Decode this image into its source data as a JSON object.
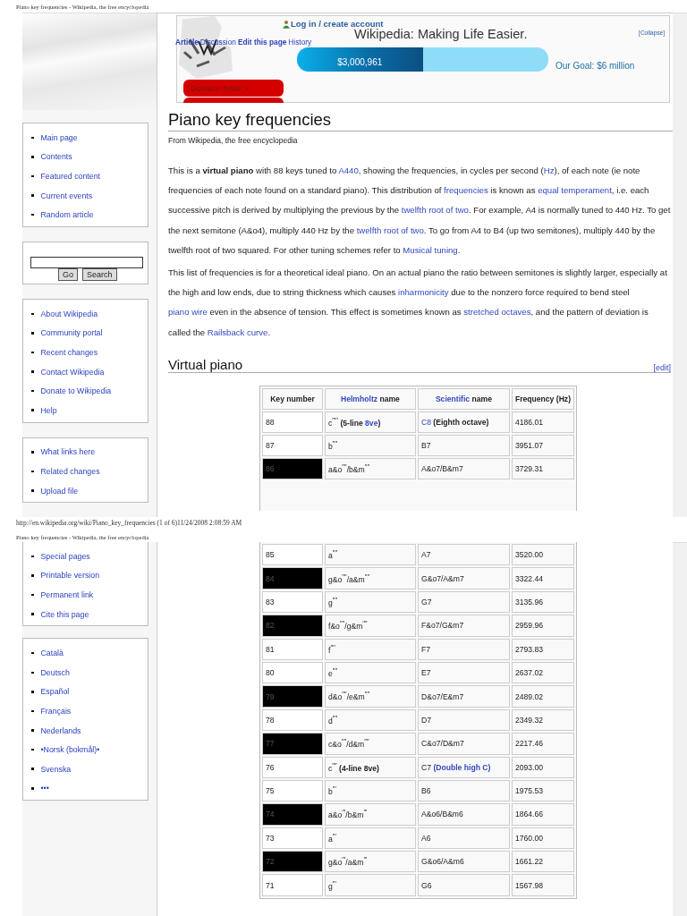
{
  "sheets": [
    {
      "running_head": "Piano key frequencies - Wikipedia, the free encyclopedia",
      "running_foot": "http://en.wikipedia.org/wiki/Piano_key_frequencies (1 of 6)11/24/2008 2:08:59 AM",
      "sidebar": [
        {
          "kind": "links",
          "items": [
            "Main page",
            "Contents",
            "Featured content",
            "Current events",
            "Random article"
          ]
        },
        {
          "kind": "search",
          "buttons": [
            "Go",
            "Search"
          ]
        },
        {
          "kind": "links",
          "items": [
            "About Wikipedia",
            "Community portal",
            "Recent changes",
            "Contact Wikipedia",
            "Donate to Wikipedia",
            "Help"
          ]
        },
        {
          "kind": "links",
          "items": [
            "What links here",
            "Related changes",
            "Upload file"
          ]
        }
      ]
    },
    {
      "running_head": "Piano key frequencies - Wikipedia, the free encyclopedia",
      "sidebar": [
        {
          "kind": "links",
          "items": [
            "Special pages",
            "Printable version",
            "Permanent link",
            "Cite this page"
          ]
        },
        {
          "kind": "links",
          "items": [
            "Català",
            "Deutsch",
            "Español",
            "Français",
            "Nederlands",
            "•Norsk (bokmål)•",
            "Svenska",
            "•••"
          ]
        }
      ]
    }
  ],
  "banner": {
    "login": "Log in / create account",
    "tabs": [
      {
        "label": "Article",
        "bold": true
      },
      {
        "label": "Discussion",
        "bold": false
      },
      {
        "label": "Edit this page",
        "bold": true
      },
      {
        "label": "History",
        "bold": false
      }
    ],
    "slogan": "Wikipedia: Making Life Easier.",
    "collapse": "[Collapse]",
    "progress": {
      "level": 0.5,
      "reading": "$3,000,961"
    },
    "goal": "Our Goal: $6 million",
    "donate": "Donate Now »"
  },
  "article": {
    "title": "Piano key frequencies",
    "subtitle": "From Wikipedia, the free encyclopedia",
    "paragraphs": [
      [
        {
          "kind": "text",
          "t": "This is a "
        },
        {
          "kind": "bold",
          "t": "virtual piano"
        },
        {
          "kind": "text",
          "t": " with 88 keys tuned to "
        },
        {
          "kind": "link",
          "t": "A440"
        },
        {
          "kind": "text",
          "t": ", showing the frequencies, in cycles per second ("
        },
        {
          "kind": "link",
          "t": "Hz"
        },
        {
          "kind": "text",
          "t": "), of each note (ie note frequencies of each note found on a standard piano). This distribution of "
        },
        {
          "kind": "link",
          "t": "frequencies"
        },
        {
          "kind": "text",
          "t": " is known as "
        },
        {
          "kind": "link",
          "t": "equal temperament"
        },
        {
          "kind": "text",
          "t": ", i.e. each successive pitch is derived by multiplying the previous by the "
        },
        {
          "kind": "link",
          "t": "twelfth root of two"
        },
        {
          "kind": "text",
          "t": ". For example, A4 is normally tuned to 440 Hz. To get the next semitone (A&o4), multiply 440 Hz by the "
        },
        {
          "kind": "link",
          "t": "twelfth root of two"
        },
        {
          "kind": "text",
          "t": ". To go from A4 to B4 (up two semitones), multiply 440 by the twelfth root of two squared. For other tuning schemes refer to "
        },
        {
          "kind": "link",
          "t": "Musical tuning"
        },
        {
          "kind": "text",
          "t": "."
        }
      ],
      [
        {
          "kind": "text",
          "t": "This list of frequencies is for a theoretical ideal piano. On an actual piano the ratio between semitones is slightly larger, especially at the high and low ends, due to string thickness which causes "
        },
        {
          "kind": "link",
          "t": "inharmonicity"
        },
        {
          "kind": "text",
          "t": " due to the nonzero force required to bend steel "
        },
        {
          "kind": "link",
          "t": "piano wire"
        },
        {
          "kind": "text",
          "t": " even in the absence of tension. This effect is sometimes known as "
        },
        {
          "kind": "link",
          "t": "stretched octaves"
        },
        {
          "kind": "text",
          "t": ", and the pattern of deviation is called the "
        },
        {
          "kind": "link",
          "t": "Railsback curve"
        },
        {
          "kind": "text",
          "t": "."
        }
      ]
    ],
    "section": {
      "heading": "Virtual piano",
      "edit": "[edit]"
    },
    "table": {
      "columns": [
        [
          {
            "kind": "bold",
            "t": "Key number"
          }
        ],
        [
          {
            "kind": "link",
            "t": "Helmholtz"
          },
          {
            "kind": "bold",
            "t": " name"
          }
        ],
        [
          {
            "kind": "link",
            "t": "Scientific"
          },
          {
            "kind": "bold",
            "t": " name"
          }
        ],
        [
          {
            "kind": "bold",
            "t": "Frequency (Hz)"
          }
        ]
      ],
      "sheet_1_rows": [
        {
          "key": "88",
          "black": false,
          "helmholtz": [
            {
              "kind": "text",
              "t": "c$^{′′′′′}$ "
            },
            {
              "kind": "bold",
              "t": "(5-line "
            },
            {
              "kind": "link",
              "t": "8ve"
            },
            {
              "kind": "bold",
              "t": ")"
            }
          ],
          "scientific": [
            {
              "kind": "link",
              "t": "C8"
            },
            {
              "kind": "bold",
              "t": " (Eighth octave)"
            }
          ],
          "frequency": "4186.01"
        },
        {
          "key": "87",
          "black": false,
          "helmholtz": [
            {
              "kind": "text",
              "t": "b$^{′′′′}$"
            }
          ],
          "scientific": [
            {
              "kind": "text",
              "t": "B7"
            }
          ],
          "frequency": "3951.07"
        },
        {
          "key": "86",
          "black": true,
          "helmholtz": [
            {
              "kind": "text",
              "t": "a&o$^{′′′′}$/b&m$^{′′′′}$"
            }
          ],
          "scientific": [
            {
              "kind": "text",
              "t": "A&o7/B&m7"
            }
          ],
          "frequency": "3729.31"
        }
      ],
      "sheet_2_rows": [
        {
          "key": "85",
          "black": false,
          "helmholtz": [
            {
              "kind": "text",
              "t": "a$^{′′′′}$"
            }
          ],
          "scientific": [
            {
              "kind": "text",
              "t": "A7"
            }
          ],
          "frequency": "3520.00"
        },
        {
          "key": "84",
          "black": true,
          "helmholtz": [
            {
              "kind": "text",
              "t": "g&o$^{′′′′}$/a&m$^{′′′′}$"
            }
          ],
          "scientific": [
            {
              "kind": "text",
              "t": "G&o7/A&m7"
            }
          ],
          "frequency": "3322.44"
        },
        {
          "key": "83",
          "black": false,
          "helmholtz": [
            {
              "kind": "text",
              "t": "g$^{′′′′}$"
            }
          ],
          "scientific": [
            {
              "kind": "text",
              "t": "G7"
            }
          ],
          "frequency": "3135.96"
        },
        {
          "key": "82",
          "black": true,
          "helmholtz": [
            {
              "kind": "text",
              "t": "f&o$^{′′′′}$/g&m$^{′′′′}$"
            }
          ],
          "scientific": [
            {
              "kind": "text",
              "t": "F&o7/G&m7"
            }
          ],
          "frequency": "2959.96"
        },
        {
          "key": "81",
          "black": false,
          "helmholtz": [
            {
              "kind": "text",
              "t": "f$^{′′′′}$"
            }
          ],
          "scientific": [
            {
              "kind": "text",
              "t": "F7"
            }
          ],
          "frequency": "2793.83"
        },
        {
          "key": "80",
          "black": false,
          "helmholtz": [
            {
              "kind": "text",
              "t": "e$^{′′′′}$"
            }
          ],
          "scientific": [
            {
              "kind": "text",
              "t": "E7"
            }
          ],
          "frequency": "2637.02"
        },
        {
          "key": "79",
          "black": true,
          "helmholtz": [
            {
              "kind": "text",
              "t": "d&o$^{′′′′}$/e&m$^{′′′′}$"
            }
          ],
          "scientific": [
            {
              "kind": "text",
              "t": "D&o7/E&m7"
            }
          ],
          "frequency": "2489.02"
        },
        {
          "key": "78",
          "black": false,
          "helmholtz": [
            {
              "kind": "text",
              "t": "d$^{′′′′}$"
            }
          ],
          "scientific": [
            {
              "kind": "text",
              "t": "D7"
            }
          ],
          "frequency": "2349.32"
        },
        {
          "key": "77",
          "black": true,
          "helmholtz": [
            {
              "kind": "text",
              "t": "c&o$^{′′′′}$/d&m$^{′′′′}$"
            }
          ],
          "scientific": [
            {
              "kind": "text",
              "t": "C&o7/D&m7"
            }
          ],
          "frequency": "2217.46"
        },
        {
          "key": "76",
          "black": false,
          "helmholtz": [
            {
              "kind": "text",
              "t": "c$^{′′′′}$ "
            },
            {
              "kind": "bold",
              "t": "(4-line 8ve)"
            }
          ],
          "scientific": [
            {
              "kind": "text",
              "t": "C7 "
            },
            {
              "kind": "link",
              "t": "(Double high C)"
            }
          ],
          "frequency": "2093.00"
        },
        {
          "key": "75",
          "black": false,
          "helmholtz": [
            {
              "kind": "text",
              "t": "b$^{′′′}$"
            }
          ],
          "scientific": [
            {
              "kind": "text",
              "t": "B6"
            }
          ],
          "frequency": "1975.53"
        },
        {
          "key": "74",
          "black": true,
          "helmholtz": [
            {
              "kind": "text",
              "t": "a&o$^{′′′}$/b&m$^{′′′}$"
            }
          ],
          "scientific": [
            {
              "kind": "text",
              "t": "A&o6/B&m6"
            }
          ],
          "frequency": "1864.66"
        },
        {
          "key": "73",
          "black": false,
          "helmholtz": [
            {
              "kind": "text",
              "t": "a$^{′′′}$"
            }
          ],
          "scientific": [
            {
              "kind": "text",
              "t": "A6"
            }
          ],
          "frequency": "1760.00"
        },
        {
          "key": "72",
          "black": true,
          "helmholtz": [
            {
              "kind": "text",
              "t": "g&o$^{′′′}$/a&m$^{′′′}$"
            }
          ],
          "scientific": [
            {
              "kind": "text",
              "t": "G&o6/A&m6"
            }
          ],
          "frequency": "1661.22"
        },
        {
          "key": "71",
          "black": false,
          "helmholtz": [
            {
              "kind": "text",
              "t": "g$^{′′′}$"
            }
          ],
          "scientific": [
            {
              "kind": "text",
              "t": "G6"
            }
          ],
          "frequency": "1567.98"
        }
      ]
    }
  }
}
